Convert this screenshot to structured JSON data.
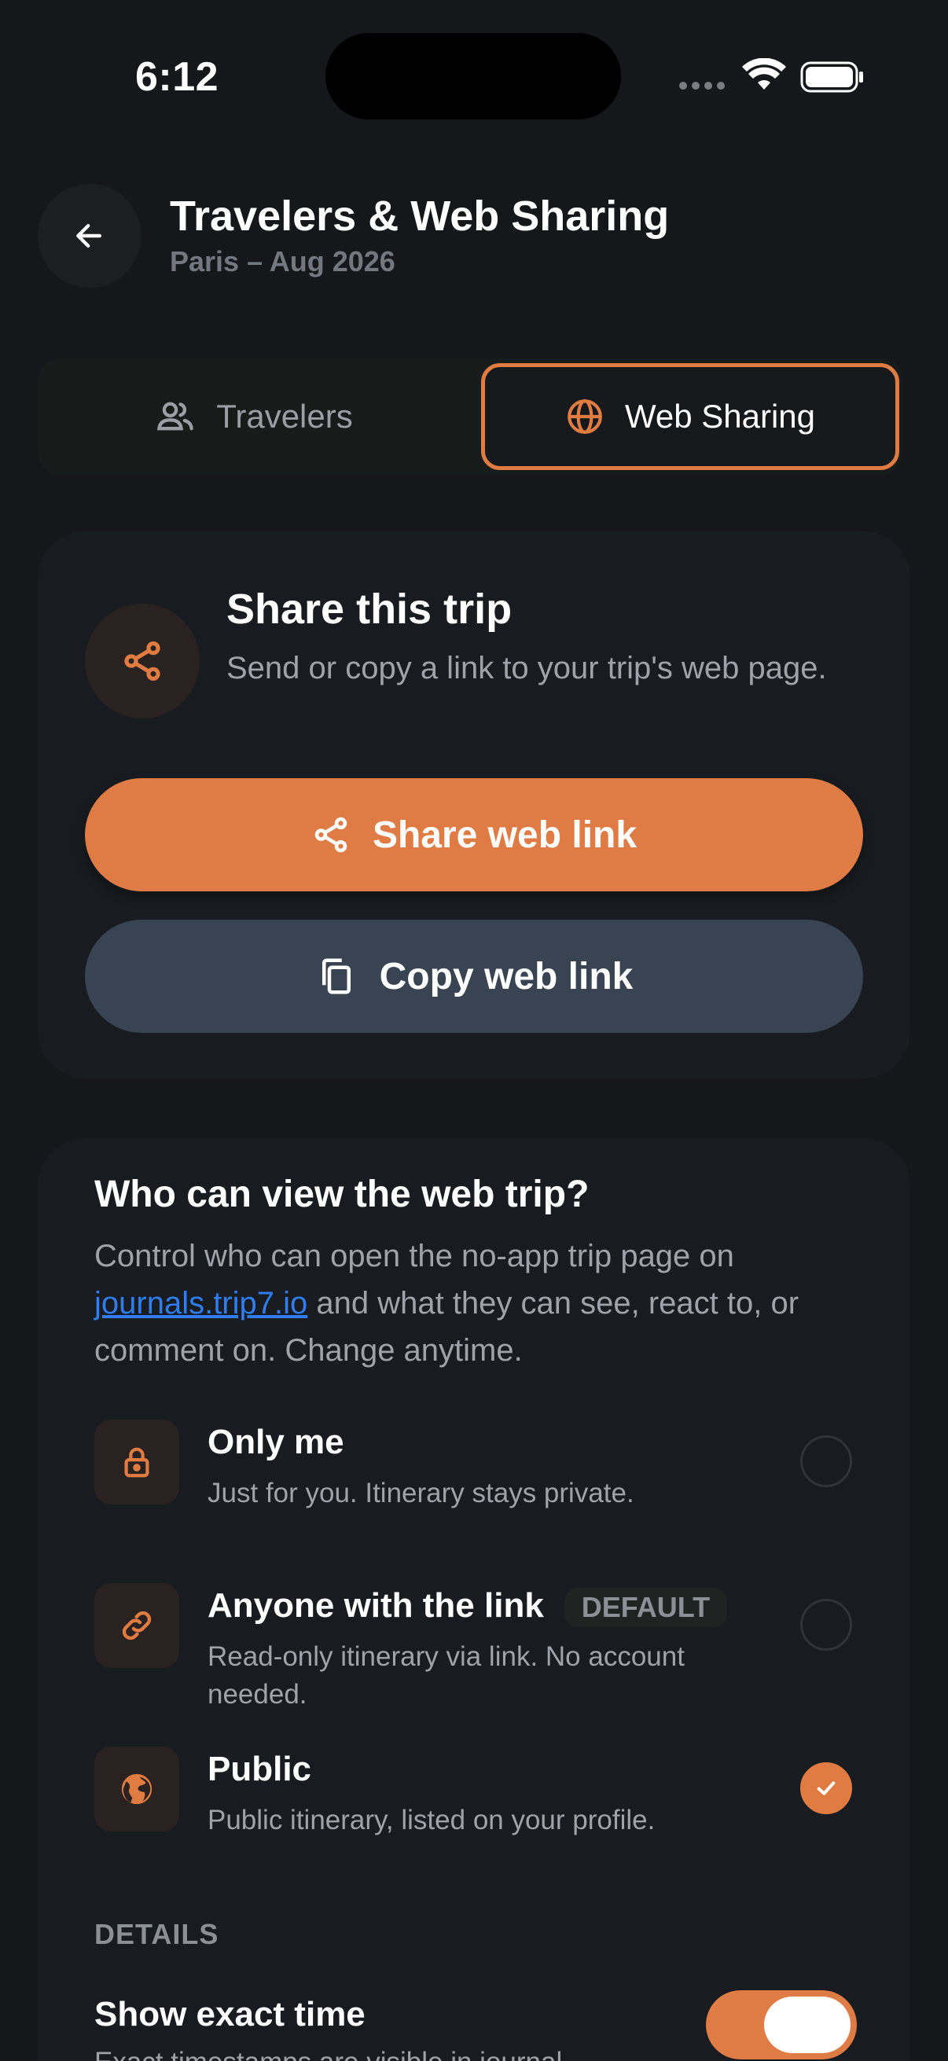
{
  "status_bar": {
    "time": "6:12"
  },
  "header": {
    "title": "Travelers & Web Sharing",
    "subtitle": "Paris – Aug 2026"
  },
  "tabs": [
    {
      "label": "Travelers",
      "icon": "people-icon",
      "selected": false
    },
    {
      "label": "Web Sharing",
      "icon": "globe-icon",
      "selected": true
    }
  ],
  "share_card": {
    "title": "Share this trip",
    "description": "Send or copy a link to your trip's web page.",
    "share_button": "Share web link",
    "copy_button": "Copy web link"
  },
  "visibility": {
    "title": "Who can view the web trip?",
    "desc_before": "Control who can open the no-app trip page on ",
    "link_text": "journals.trip7.io",
    "desc_after": " and what they can see, react to, or comment on. Change anytime.",
    "options": [
      {
        "title": "Only me",
        "description": "Just for you. Itinerary stays private.",
        "icon": "lock-icon",
        "selected": false
      },
      {
        "title": "Anyone with the link",
        "badge": "DEFAULT",
        "description": "Read-only itinerary via link. No account needed.",
        "icon": "link-icon",
        "selected": false
      },
      {
        "title": "Public",
        "description": "Public itinerary, listed on your profile.",
        "icon": "globe-icon",
        "selected": true
      }
    ]
  },
  "details": {
    "label": "DETAILS",
    "show_exact_time": {
      "title": "Show exact time",
      "description": "Exact timestamps are visible in journal",
      "enabled": true
    }
  },
  "colors": {
    "accent": "#e07b42",
    "background": "#15171b",
    "card": "#181b1f",
    "secondary_button": "#394453",
    "link": "#2f7df0"
  }
}
